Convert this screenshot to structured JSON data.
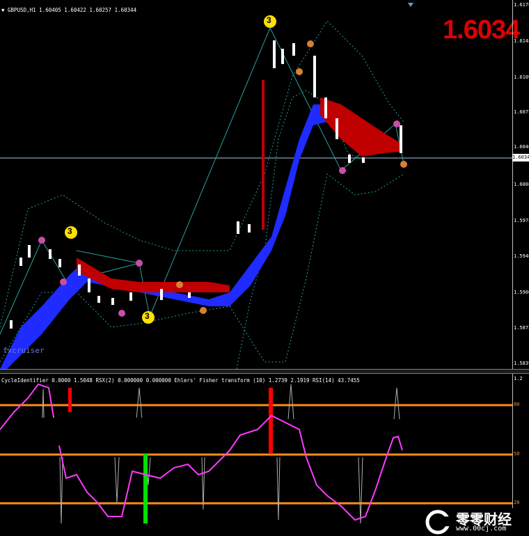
{
  "main_panel": {
    "symbol_info": "▼ GBPUSD,H1  1.60405 1.60422 1.60257 1.60344",
    "big_price": "1.6034",
    "watermark": "fxcruiser",
    "current_price_tag": "1.6034",
    "price_axis": [
      "1.6176",
      "1.6148",
      "1.6109",
      "1.6075",
      "1.6040",
      "1.6008",
      "1.5974",
      "1.5940",
      "1.5906",
      "1.5872",
      "1.5839"
    ],
    "wave_markers": [
      "3",
      "3",
      "3"
    ],
    "small_markers_orange": [
      "0",
      "0",
      "0",
      "0",
      "0"
    ],
    "small_markers_pink": [
      "0",
      "0",
      "0",
      "0",
      "0",
      "0"
    ]
  },
  "sub_panel": {
    "indicator_info": "CycleIdentifier 0.0000 1.5048  RSX(2) 0.000000 0.000000  Ehlers' Fisher transform (10) 1.2739 2.1919  RSI(14) 43.7455",
    "axis_labels": [
      "1.2",
      "80",
      "50",
      "20"
    ]
  },
  "logo": {
    "cn_text": "零零财经",
    "url_text": "www.00cj.com"
  },
  "colors": {
    "background": "#000000",
    "bull_cloud": "#1f2bff",
    "bear_cloud": "#c00000",
    "band": "#2aa0a0",
    "level_line": "#ff8c1a",
    "rsi_line": "#ff3aff",
    "big_price": "#e00000"
  }
}
